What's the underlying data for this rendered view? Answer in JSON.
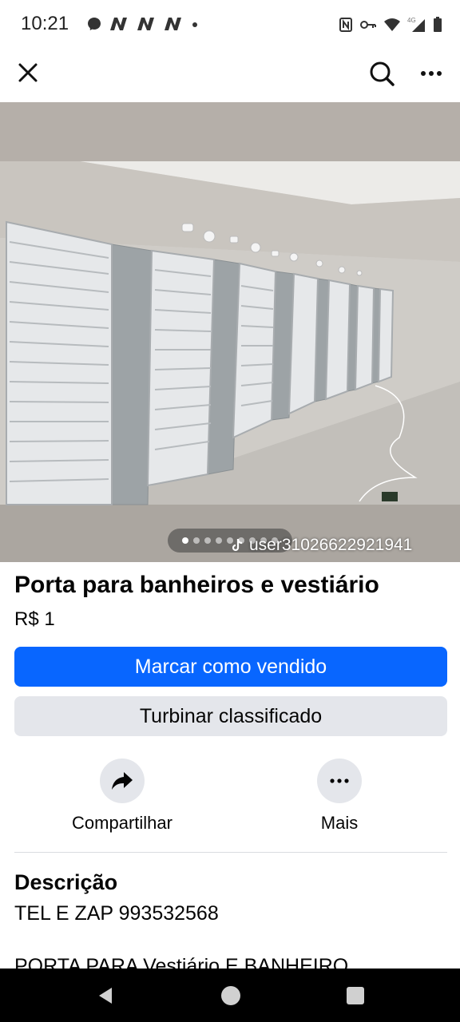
{
  "status_bar": {
    "time": "10:21",
    "left_icons": [
      "messenger-icon",
      "n-icon",
      "n-icon",
      "n-icon",
      "dot-icon"
    ],
    "right_icons": [
      "nfc-icon",
      "key-icon",
      "wifi-icon",
      "signal-4g-icon",
      "battery-icon"
    ],
    "network_label": "4G"
  },
  "app_bar": {
    "close_icon": "close-icon",
    "search_icon": "search-icon",
    "more_icon": "more-horizontal-icon"
  },
  "photo": {
    "pager_total": 9,
    "pager_active_index": 0,
    "watermark": "user31026622921941"
  },
  "listing": {
    "title": "Porta para banheiros e vestiário",
    "price": "R$ 1",
    "mark_sold_label": "Marcar como vendido",
    "boost_label": "Turbinar classificado",
    "share_label": "Compartilhar",
    "more_label": "Mais"
  },
  "description": {
    "heading": "Descrição",
    "line_1": "TEL E ZAP 993532568",
    "line_2": "PORTA PARA Vestiário E BANHEIRO"
  },
  "colors": {
    "primary": "#0866ff",
    "secondary_bg": "#e4e6eb"
  }
}
